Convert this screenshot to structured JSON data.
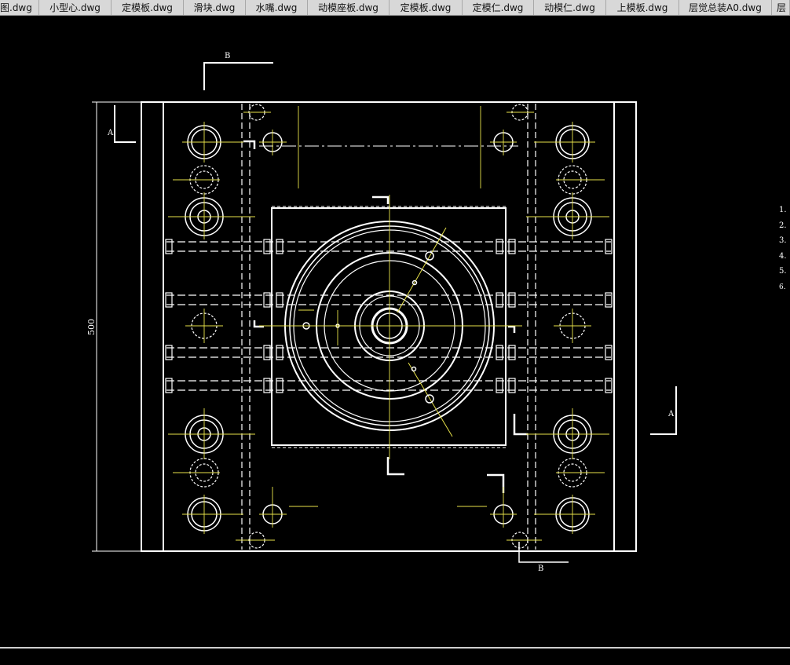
{
  "tabs": [
    "图.dwg",
    "小型心.dwg",
    "定模板.dwg",
    "滑块.dwg",
    "水嘴.dwg",
    "动模座板.dwg",
    "定模板.dwg",
    "定模仁.dwg",
    "动模仁.dwg",
    "上模板.dwg",
    "层觉总装A0.dwg",
    "层"
  ],
  "drawing": {
    "section_b_top": "B",
    "section_b_bottom": "B",
    "section_a_left": "A",
    "section_a_right": "A",
    "dimension_height": "500",
    "notes": [
      "1.",
      "2.",
      "3.",
      "4.",
      "5.",
      "6."
    ]
  },
  "colors": {
    "background": "#000000",
    "outline": "#ffffff",
    "centerline": "#e8e24a",
    "tabbar": "#d8d8d8"
  }
}
